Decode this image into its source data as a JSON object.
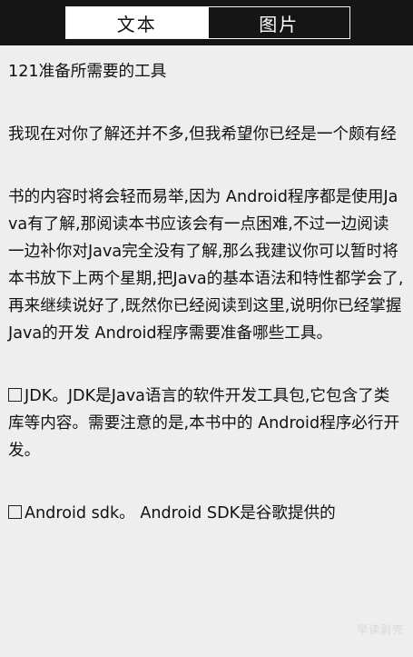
{
  "tabs": {
    "text_label": "文本",
    "image_label": "图片"
  },
  "article": {
    "title": "121准备所需要的工具",
    "intro": "我现在对你了解还并不多,但我希望你已经是一个颇有经",
    "book_paragraph": "书的内容时将会轻而易举,因为 Android程序都是使用Java有了解,那阅读本书应该会有一点困难,不过一边阅读一边补你对Java完全没有了解,那么我建议你可以暂时将本书放下上两个星期,把Java的基本语法和特性都学会了,再来继续说好了,既然你已经阅读到这里,说明你已经掌握Java的开发 Android程序需要准备哪些工具。",
    "jdk_item": "JDK。JDK是Java语言的软件开发工具包,它包含了类库等内容。需要注意的是,本书中的 Android程序必行开发。",
    "sdk_item": "Android sdk。 Android SDK是谷歌提供的"
  },
  "watermark": "早读剥壳",
  "colors": {
    "topbar": "#151515",
    "content_bg": "#eeeeee",
    "text": "#111111"
  }
}
